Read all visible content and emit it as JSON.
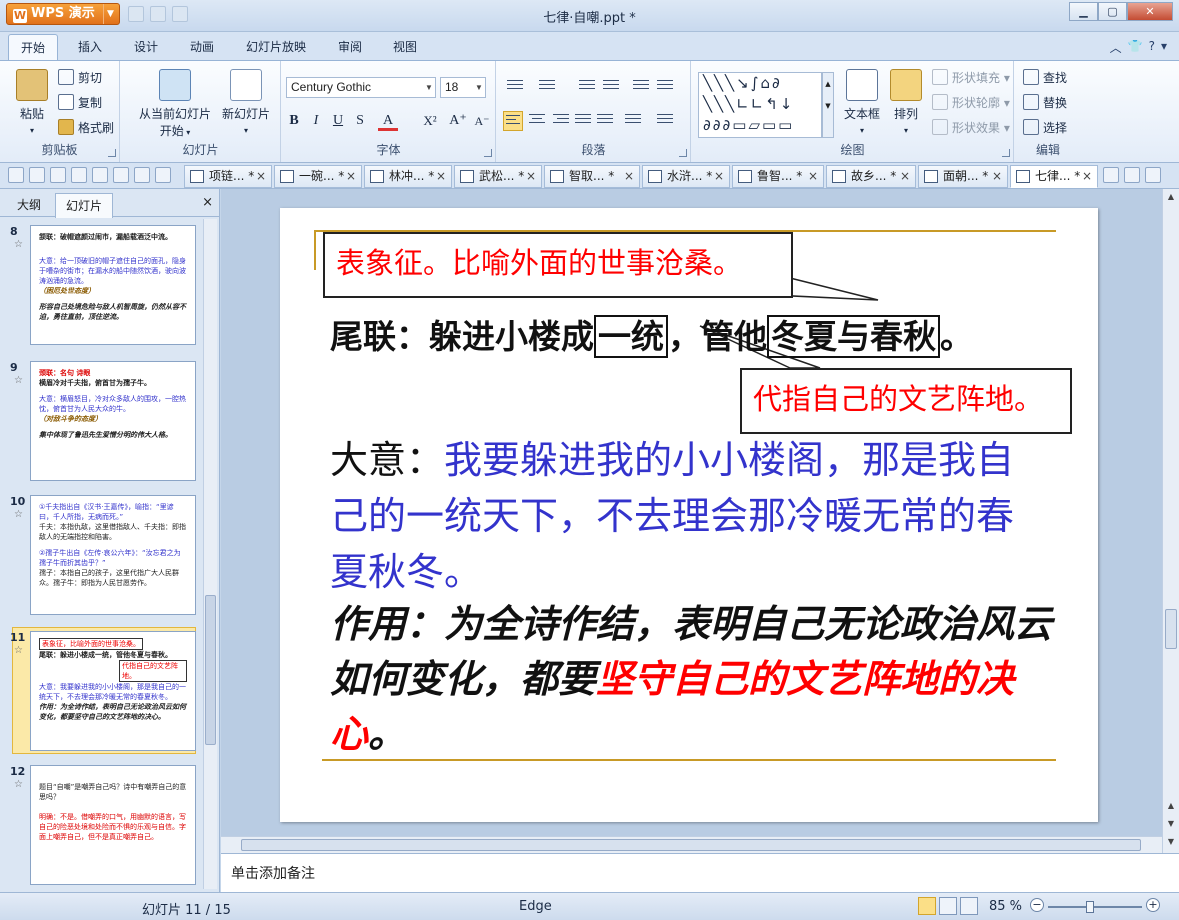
{
  "app": {
    "menu_label": "WPS 演示",
    "window_title": "七律·自嘲.ppt *",
    "colors": {
      "accent": "#e1711b",
      "ribbon": "#dbe6f3",
      "slide_gold": "#c89a26",
      "text_blue": "#3333cc",
      "text_red": "#ff0000"
    }
  },
  "ribbon_tabs": [
    "开始",
    "插入",
    "设计",
    "动画",
    "幻灯片放映",
    "审阅",
    "视图"
  ],
  "ribbon": {
    "clipboard": {
      "label": "剪贴板",
      "paste": "粘贴",
      "cut": "剪切",
      "copy": "复制",
      "format_painter": "格式刷"
    },
    "slides": {
      "label": "幻灯片",
      "from_current_1": "从当前幻灯片",
      "from_current_2": "开始",
      "new_slide": "新幻灯片"
    },
    "font": {
      "label": "字体",
      "font_name": "Century Gothic",
      "font_size": "18"
    },
    "paragraph": {
      "label": "段落"
    },
    "drawing": {
      "label": "绘图",
      "textbox": "文本框",
      "arrange": "排列",
      "shape_fill": "形状填充",
      "shape_outline": "形状轮廓",
      "shape_effect": "形状效果"
    },
    "editing": {
      "label": "编辑",
      "find": "查找",
      "replace": "替换",
      "select": "选择"
    }
  },
  "doc_tabs": [
    {
      "title": "项链... *",
      "active": false
    },
    {
      "title": "一碗... *",
      "active": false
    },
    {
      "title": "林冲... *",
      "active": false
    },
    {
      "title": "武松... *",
      "active": false
    },
    {
      "title": "智取... *",
      "active": false
    },
    {
      "title": "水浒... *",
      "active": false
    },
    {
      "title": "鲁智... *",
      "active": false
    },
    {
      "title": "故乡... *",
      "active": false
    },
    {
      "title": "面朝... *",
      "active": false
    },
    {
      "title": "七律... *",
      "active": true
    }
  ],
  "left_panel": {
    "tab_outline": "大纲",
    "tab_slides": "幻灯片",
    "close": "×",
    "thumbs": [
      {
        "num": "8",
        "lines": [
          "颔联：破帽遮颜过闹市，漏船载酒泛中流。",
          "大意：给一顶破旧的帽子遮住自己的面孔，隐身于嘈杂的街市；在漏水的船中随然饮酒，驶向波涛汹涌的急流。",
          "（困厄处世态度）",
          "形容自己处境危险与敌人机智周旋，仍然从容不迫，勇往直前，顶住逆流。"
        ]
      },
      {
        "num": "9",
        "lines": [
          "颈联：名句 诗眼",
          "横眉冷对千夫指，俯首甘为孺子牛。",
          "大意：横眉怒目，冷对众多敌人的围攻，一腔热忱，俯首甘为人民大众的牛。",
          "（对敌斗争的态度）",
          "集中体现了鲁迅先生爱憎分明的伟大人格。"
        ]
      },
      {
        "num": "10",
        "lines": [
          "①千夫指出自《汉书·王嘉传》，喻指：“里谚曰，千人所指，无病而死。”",
          "千夫：本指仇敌，这里借指敌人、千夫指：即指敌人的无端指控和陷害。",
          "②孺子牛出自《左传·哀公六年》：“汝忘君之为孺子牛而折其齿乎？”",
          "孺子：本指自己的孩子，这里代指广大人民群众。孺子牛：即指为人民甘愿劳作。"
        ]
      },
      {
        "num": "11",
        "lines": [
          "表象征，比喻外面的世事沧桑。",
          "尾联：躲进小楼成一统，管他冬夏与春秋。",
          "代指自己的文艺阵地。",
          "大意：我要躲进我的小小楼阁，那是我自己的一统天下，不去理会那冷暖无常的春夏秋冬。",
          "作用：为全诗作结，表明自己无论政治风云如何变化，都要坚守自己的文艺阵地的决心。"
        ]
      },
      {
        "num": "12",
        "lines": [
          "题目“自嘲”是嘲弄自己吗？诗中有嘲弄自己的意思吗？",
          "明确：不是。借嘲弄的口气，用幽默的语言，写自己的险恶处境和处险而不惧的乐观与自信。字面上嘲弄自己，但不是真正嘲弄自己。"
        ]
      }
    ]
  },
  "slide": {
    "callout_top": "表象征。比喻外面的世事沧桑。",
    "l1_prefix": "尾联：躲进小楼成",
    "l1_box1": "一统",
    "l1_mid": "，管他",
    "l1_box2": "冬夏与春秋",
    "l1_end": "。",
    "callout_right": "代指自己的文艺阵地。",
    "meaning_label": "大意：",
    "meaning_text": "我要躲进我的小小楼阁，那是我自己的一统天下，不去理会那冷暖无常的春夏秋冬。",
    "function_text": "作用：为全诗作结，表明自己无论政治风云如何变化，都要",
    "function_red": "坚守自己的文艺阵地的决心",
    "function_end": "。"
  },
  "notes": {
    "placeholder": "单击添加备注"
  },
  "status": {
    "slide_info": "幻灯片 11 / 15",
    "theme": "Edge",
    "zoom": "85 %"
  }
}
